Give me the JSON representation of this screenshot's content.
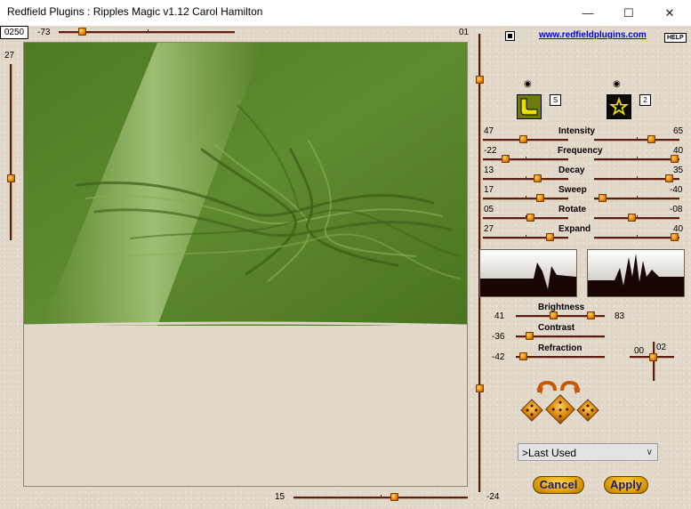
{
  "window": {
    "title": "Redfield Plugins : Ripples Magic v1.12   Carol Hamilton",
    "minimize_glyph": "—",
    "maximize_glyph": "☐",
    "close_glyph": "✕"
  },
  "top": {
    "seed_box": "0250",
    "x_offset": "-73",
    "top_right_value": "01",
    "link": "www.redfieldplugins.com",
    "help": "HELP"
  },
  "left_slider_value": "27",
  "bottom_slider_value": "15",
  "right_slider_value": "-24",
  "swatches": {
    "left_number": "S",
    "right_number": "2"
  },
  "params": [
    {
      "name": "Intensity",
      "left": "47",
      "right": "65"
    },
    {
      "name": "Frequency",
      "left": "-22",
      "right": "40"
    },
    {
      "name": "Decay",
      "left": "13",
      "right": "35"
    },
    {
      "name": "Sweep",
      "left": "17",
      "right": "-40"
    },
    {
      "name": "Rotate",
      "left": "05",
      "right": "-08"
    },
    {
      "name": "Expand",
      "left": "27",
      "right": "40"
    }
  ],
  "lighting": {
    "brightness_label": "Brightness",
    "brightness_left": "41",
    "brightness_right": "83",
    "contrast_label": "Contrast",
    "contrast_value": "-36",
    "refraction_label": "Refraction",
    "refraction_value": "-42",
    "light_x": "00",
    "light_y": "02"
  },
  "preset": {
    "selected": ">Last Used"
  },
  "buttons": {
    "cancel": "Cancel",
    "apply": "Apply"
  },
  "colors": {
    "preview_green": "#5f8a2e",
    "track": "#5a1e12",
    "knob": "#e58a08"
  }
}
